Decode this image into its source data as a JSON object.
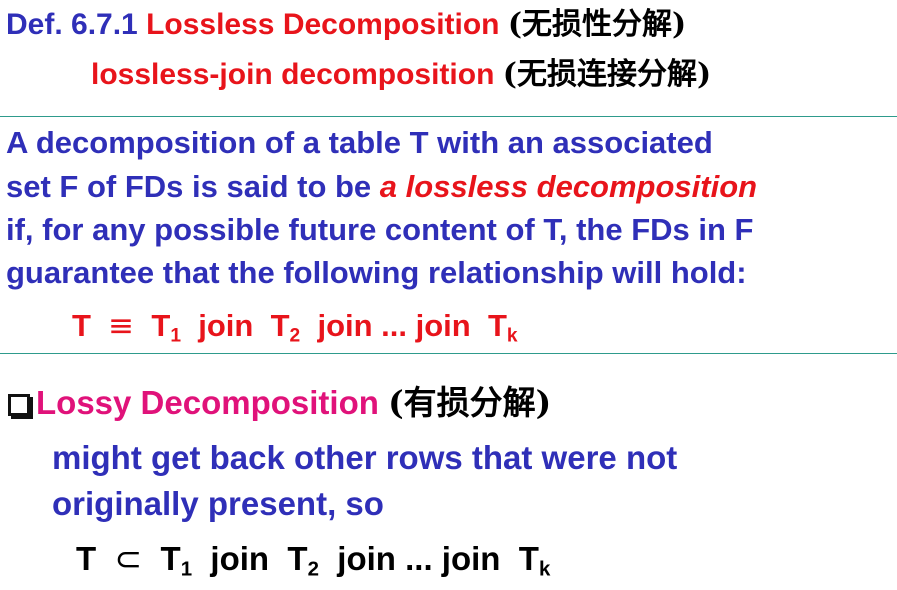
{
  "def": {
    "number": "Def. 6.7.1",
    "title": "Lossless Decomposition",
    "title_cn": "(无损性分解)",
    "alt_title": "lossless-join decomposition",
    "alt_title_cn": "(无损连接分解)"
  },
  "body": {
    "line1": "A decomposition of a table T with an associated",
    "line2_pre": "set F of FDs is said to be ",
    "line2_em": "a lossless decomposition",
    "line3": "if, for any possible future content of T, the FDs in F",
    "line4": "guarantee that the following relationship will hold:"
  },
  "formula1": {
    "t": "T",
    "rel": "≡",
    "t1": "T",
    "s1": "1",
    "join1": "join",
    "t2": "T",
    "s2": "2",
    "join2": "join ... join",
    "tk": "T",
    "sk": "k"
  },
  "lossy": {
    "title": "Lossy Decomposition",
    "title_cn": "(有损分解)",
    "line1": "might get back other rows that were not",
    "line2": "originally present, so"
  },
  "formula2": {
    "t": "T",
    "rel": "⊂",
    "t1": "T",
    "s1": "1",
    "join1": "join",
    "t2": "T",
    "s2": "2",
    "join2": "join ... join",
    "tk": "T",
    "sk": "k"
  },
  "colors": {
    "blue": "#2f2fb8",
    "red": "#e8141b",
    "magenta": "#e0127a",
    "rule": "#2e9b8c"
  }
}
